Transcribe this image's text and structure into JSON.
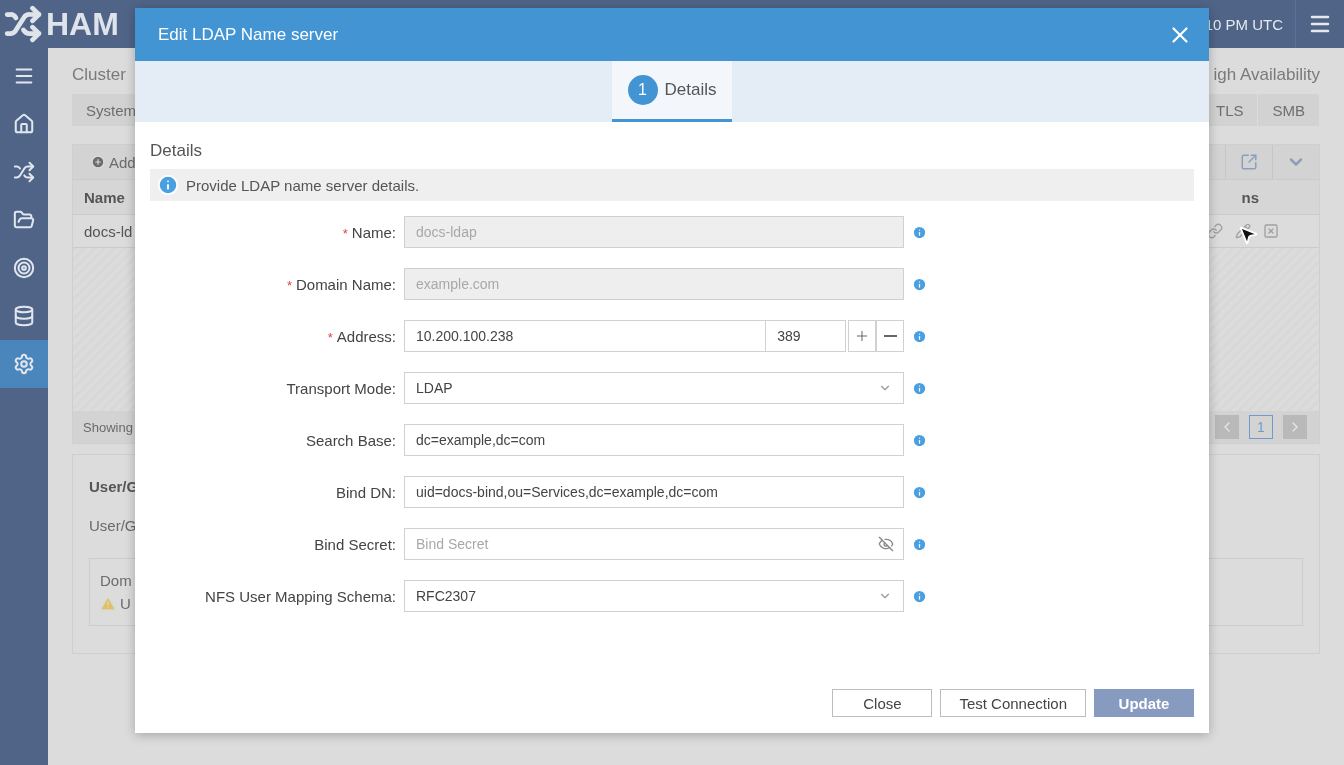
{
  "header": {
    "logo_text": "HAM",
    "time": "10 PM UTC"
  },
  "sidebar": {
    "items": [
      {
        "selected": false
      },
      {
        "selected": false
      },
      {
        "selected": false
      },
      {
        "selected": false
      },
      {
        "selected": false
      },
      {
        "selected": false
      },
      {
        "selected": true
      }
    ]
  },
  "page": {
    "title": "Cluster",
    "title_right": "igh Availability",
    "tabs": [
      {
        "label": "System",
        "selected": false
      },
      {
        "label": "TLS",
        "selected": false
      },
      {
        "label": "SMB",
        "selected": false
      }
    ],
    "table": {
      "add_label": "Add",
      "columns": [
        "Name",
        "ns"
      ],
      "rows": [
        {
          "cells": [
            "docs-ld"
          ]
        }
      ],
      "footer": "Showing",
      "pages": [
        {
          "label": "1",
          "selected": true
        }
      ]
    },
    "user_panel": {
      "title": "User/G",
      "label": "User/G",
      "notice": {
        "title": "Dom",
        "message": "U"
      }
    }
  },
  "dialog": {
    "title": "Edit LDAP Name server",
    "steps": [
      {
        "number": "1",
        "label": "Details",
        "selected": true
      }
    ],
    "section": "Details",
    "info": "Provide LDAP name server details.",
    "fields": [
      {
        "kind": "text",
        "label": "Name:",
        "required_mark": "*",
        "value": "docs-ldap",
        "disabled": true
      },
      {
        "kind": "text",
        "label": "Domain Name:",
        "required_mark": "*",
        "value": "example.com",
        "disabled": true
      },
      {
        "kind": "address",
        "label": "Address:",
        "required_mark": "*",
        "value": "10.200.100.238",
        "port": "389"
      },
      {
        "kind": "select",
        "label": "Transport Mode:",
        "value": "LDAP"
      },
      {
        "kind": "text",
        "label": "Search Base:",
        "value": "dc=example,dc=com",
        "disabled": false
      },
      {
        "kind": "text",
        "label": "Bind DN:",
        "value": "uid=docs-bind,ou=Services,dc=example,dc=com",
        "disabled": false
      },
      {
        "kind": "password",
        "label": "Bind Secret:",
        "placeholder": "Bind Secret"
      },
      {
        "kind": "select",
        "label": "NFS User Mapping Schema:",
        "value": "RFC2307"
      }
    ],
    "buttons": [
      {
        "label": "Close",
        "kind": "default",
        "disabled": false
      },
      {
        "label": "Test Connection",
        "kind": "default",
        "disabled": false
      },
      {
        "label": "Update",
        "kind": "primary",
        "disabled": true
      }
    ]
  }
}
